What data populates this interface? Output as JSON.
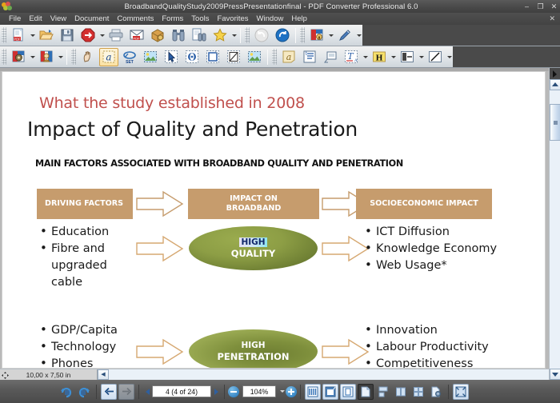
{
  "window": {
    "title": "BroadbandQualityStudy2009PressPresentationfinal - PDF Converter Professional 6.0",
    "logo_icon": "app-logo-icon",
    "minimize_label": "–",
    "restore_label": "❐",
    "close_label": "✕",
    "document_close_label": "✕"
  },
  "menubar": {
    "items": [
      {
        "label": "File"
      },
      {
        "label": "Edit"
      },
      {
        "label": "View"
      },
      {
        "label": "Document"
      },
      {
        "label": "Comments"
      },
      {
        "label": "Forms"
      },
      {
        "label": "Tools"
      },
      {
        "label": "Favorites"
      },
      {
        "label": "Window"
      },
      {
        "label": "Help"
      }
    ]
  },
  "toolbar_primary": {
    "buttons": [
      {
        "name": "create-pdf-button",
        "icon": "pdf-page-icon",
        "dropdown": true
      },
      {
        "name": "open-button",
        "icon": "open-folder-icon",
        "dropdown": false
      },
      {
        "name": "save-button",
        "icon": "floppy-disk-icon",
        "dropdown": false
      },
      {
        "name": "convert-pdf-button",
        "icon": "red-convert-icon",
        "dropdown": true
      },
      {
        "name": "print-button",
        "icon": "printer-icon",
        "dropdown": false
      },
      {
        "name": "email-button",
        "icon": "envelope-pdf-icon",
        "dropdown": false
      },
      {
        "name": "package-button",
        "icon": "package-box-icon",
        "dropdown": false
      },
      {
        "name": "search-button",
        "icon": "binoculars-icon",
        "dropdown": false
      },
      {
        "name": "find-in-document-button",
        "icon": "page-binoculars-icon",
        "dropdown": false
      },
      {
        "name": "favorites-button",
        "icon": "star-icon",
        "dropdown": true
      },
      {
        "name": "undo-button",
        "icon": "undo-arrow-icon",
        "dropdown": false
      },
      {
        "name": "redo-button",
        "icon": "redo-arrow-icon",
        "dropdown": false
      },
      {
        "name": "secure-document-button",
        "icon": "document-lock-icon",
        "dropdown": true
      },
      {
        "name": "sign-button",
        "icon": "pen-icon",
        "dropdown": true
      }
    ]
  },
  "toolbar_secondary": {
    "buttons": [
      {
        "name": "stamp-button",
        "icon": "document-stamp-icon",
        "dropdown": true
      },
      {
        "name": "certify-button",
        "icon": "document-seal-icon",
        "dropdown": true
      },
      {
        "name": "hand-tool-button",
        "icon": "hand-icon",
        "dropdown": false
      },
      {
        "name": "text-select-tool-button",
        "icon": "letter-a-select-icon",
        "dropdown": false,
        "active": true
      },
      {
        "name": "set-tool-button",
        "icon": "set-lasso-icon",
        "dropdown": false
      },
      {
        "name": "image-select-tool-button",
        "icon": "picture-icon",
        "dropdown": false
      },
      {
        "name": "object-select-tool-button",
        "icon": "cursor-arrow-icon",
        "dropdown": false
      },
      {
        "name": "loupe-tool-button",
        "icon": "loupe-icon",
        "dropdown": false
      },
      {
        "name": "crop-tool-button",
        "icon": "crop-icon",
        "dropdown": false
      },
      {
        "name": "redact-tool-button",
        "icon": "redaction-icon",
        "dropdown": false
      },
      {
        "name": "image-region-button",
        "icon": "picture-frame-icon",
        "dropdown": false
      },
      {
        "name": "note-tool-button",
        "icon": "sticky-note-a-icon",
        "dropdown": false
      },
      {
        "name": "text-box-tool-button",
        "icon": "text-box-icon",
        "dropdown": false
      },
      {
        "name": "callout-tool-button",
        "icon": "callout-icon",
        "dropdown": false
      },
      {
        "name": "text-edit-tool-button",
        "icon": "text-edit-icon",
        "dropdown": true
      },
      {
        "name": "highlight-tool-button",
        "icon": "highlighter-h-icon",
        "dropdown": true
      },
      {
        "name": "strikeout-tool-button",
        "icon": "strikeout-icon",
        "dropdown": true
      },
      {
        "name": "line-tool-button",
        "icon": "line-draw-icon",
        "dropdown": true
      }
    ]
  },
  "document": {
    "page_size_readout": "10,00 x 7,50 in",
    "slide": {
      "kicker": "What the study established in 2008",
      "title": "Impact of Quality and Penetration",
      "subtitle": "MAIN FACTORS ASSOCIATED WITH BROADBAND QUALITY AND PENETRATION",
      "band_color": "#c69c6d",
      "bands": [
        {
          "label": "DRIVING FACTORS"
        },
        {
          "label": "IMPACT ON\nBROADBAND"
        },
        {
          "label": "SOCIOECONOMIC IMPACT"
        }
      ],
      "row_quality": {
        "left_bullets": [
          "Education",
          "Fibre and upgraded cable"
        ],
        "ellipse_line1": "HIGH",
        "ellipse_line1_selected": true,
        "ellipse_line2": "QUALITY",
        "right_bullets": [
          "ICT Diffusion",
          "Knowledge Economy",
          "Web Usage*"
        ]
      },
      "row_penetration": {
        "left_bullets": [
          "GDP/Capita",
          "Technology",
          "Phones"
        ],
        "ellipse_line1": "HIGH",
        "ellipse_line2": "PENETRATION",
        "right_bullets": [
          "Innovation",
          "Labour Productivity",
          "Competitiveness"
        ]
      }
    }
  },
  "statusbar": {
    "rotate_clockwise_icon": "rotate-clockwise-icon",
    "rotate_counterclockwise_icon": "rotate-counterclockwise-icon",
    "back_label": "←",
    "forward_label": "→",
    "previous_page_icon": "triangle-left-icon",
    "next_page_icon": "triangle-right-icon",
    "page_value": "4 (4 of 24)",
    "zoom_out_icon": "zoom-out-circle-icon",
    "zoom_value": "104%",
    "zoom_in_icon": "zoom-in-circle-icon",
    "view_buttons": [
      {
        "name": "actual-size-button",
        "icon": "actual-size-icon"
      },
      {
        "name": "fit-width-button",
        "icon": "fit-width-icon"
      },
      {
        "name": "fit-page-button",
        "icon": "fit-page-icon"
      },
      {
        "name": "single-page-view-button",
        "icon": "single-page-icon",
        "selected": true
      },
      {
        "name": "continuous-view-button",
        "icon": "continuous-page-icon"
      },
      {
        "name": "facing-pages-view-button",
        "icon": "facing-pages-icon"
      },
      {
        "name": "continuous-facing-view-button",
        "icon": "continuous-facing-icon"
      },
      {
        "name": "page-properties-button",
        "icon": "page-gear-icon"
      },
      {
        "name": "full-screen-button",
        "icon": "full-screen-icon"
      }
    ]
  }
}
